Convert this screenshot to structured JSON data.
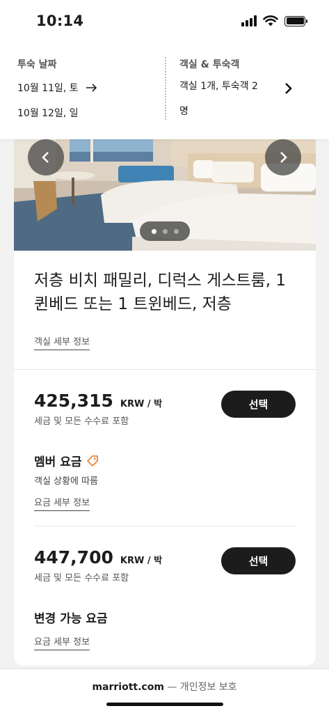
{
  "status_bar": {
    "time": "10:14"
  },
  "booking": {
    "dates_label": "투숙 날짜",
    "checkin": "10월 11일, 토",
    "checkout": "10월 12일, 일",
    "guests_label": "객실 & 투숙객",
    "guests_value": "객실 1개, 투숙객 2 명"
  },
  "room": {
    "title": "저층 비치 패밀리, 디럭스 게스트룸, 1 퀸베드 또는 1 트윈베드, 저층",
    "details_link": "객실 세부 정보",
    "photo_count": 3,
    "photo_active_index": 0
  },
  "rates": [
    {
      "price": "425,315",
      "unit": "KRW / 박",
      "tax_note": "세금 및 모든 수수료 포함",
      "select_label": "선택",
      "name": "멤버 요금",
      "subtitle": "객실 상황에 따름",
      "details_link": "요금 세부 정보"
    },
    {
      "price": "447,700",
      "unit": "KRW / 박",
      "tax_note": "세금 및 모든 수수료 포함",
      "select_label": "선택",
      "name": "변경 가능 요금",
      "details_link": "요금 세부 정보"
    }
  ],
  "footer": {
    "domain": "marriott.com",
    "suffix": "— 개인정보 보호"
  },
  "colors": {
    "tag_icon": "#e8843c",
    "button_bg": "#1c1c1c"
  }
}
